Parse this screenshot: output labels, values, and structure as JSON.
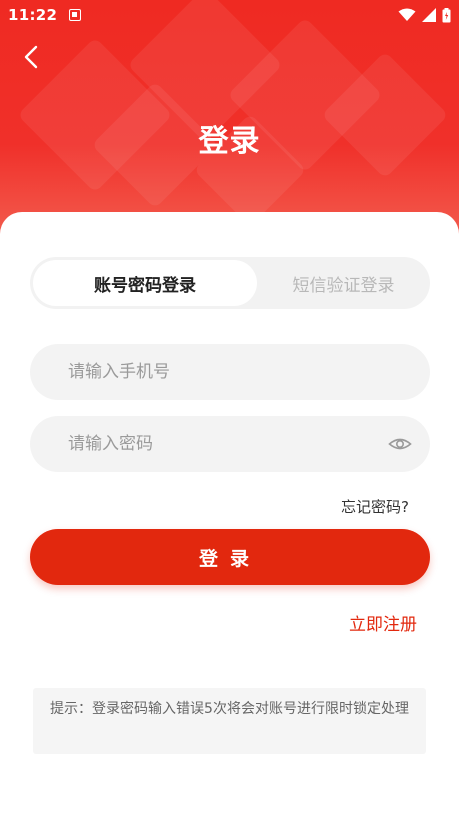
{
  "status_bar": {
    "time": "11:22"
  },
  "header": {
    "title": "登录"
  },
  "tabs": [
    {
      "label": "账号密码登录",
      "active": true
    },
    {
      "label": "短信验证登录",
      "active": false
    }
  ],
  "phone_field": {
    "placeholder": "请输入手机号",
    "value": ""
  },
  "password_field": {
    "placeholder": "请输入密码",
    "value": ""
  },
  "forgot_label": "忘记密码?",
  "login_label": "登录",
  "register_label": "立即注册",
  "notice": "提示：登录密码输入错误5次将会对账号进行限时锁定处理",
  "icons": {
    "back": "chevron-left-icon",
    "eye": "eye-icon",
    "wifi": "wifi-icon",
    "signal": "signal-icon",
    "battery": "battery-icon",
    "notification": "notification-icon"
  },
  "colors": {
    "header_red": "#ef2a22",
    "button_red": "#e2280e",
    "field_bg": "#f3f3f3"
  }
}
